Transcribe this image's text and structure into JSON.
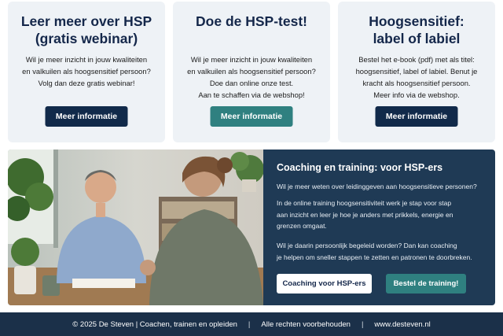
{
  "colors": {
    "navy_button": "#112a4a",
    "teal_button": "#2f8080",
    "panel_bg": "#1f3a55",
    "footer_bg": "#1b3049",
    "card_bg": "#eef2f6"
  },
  "cards": [
    {
      "title": [
        "Leer meer over HSP",
        "(gratis webinar)"
      ],
      "text": [
        "Wil je meer inzicht in jouw kwaliteiten",
        "en valkuilen als hoogsensitief persoon?",
        "Volg dan deze gratis webinar!"
      ],
      "button": "Meer informatie"
    },
    {
      "title": [
        "Doe de HSP-test!"
      ],
      "text": [
        "Wil je meer inzicht in jouw kwaliteiten",
        "en valkuilen als hoogsensitief persoon?",
        "Doe dan online onze test.",
        "Aan te schaffen via de webshop!"
      ],
      "button": "Meer informatie"
    },
    {
      "title": [
        "Hoogsensitief:",
        "label of labiel"
      ],
      "text": [
        "Bestel het e-book (pdf) met als titel:",
        "hoogsensitief, label of labiel. Benut je",
        "kracht als hoogsensitief persoon.",
        "Meer info via de webshop."
      ],
      "button": "Meer informatie"
    }
  ],
  "coaching": {
    "title": "Coaching en training: voor HSP-ers",
    "paragraphs": [
      [
        "Wil je meer weten over leidinggeven aan hoogsensitieve personen?"
      ],
      [
        "In de online training hoogsensitiviteit werk je stap voor stap",
        "aan inzicht en leer je hoe je anders met prikkels, energie en",
        "grenzen omgaat."
      ],
      [
        "Wil je daarin persoonlijk begeleid worden? Dan kan coaching",
        "je helpen om sneller stappen te zetten en patronen te doorbreken."
      ]
    ],
    "button_coaching": "Coaching voor HSP-ers",
    "button_training": "Bestel de training!"
  },
  "footer": {
    "copyright": "© 2025 De Steven | Coachen, trainen en opleiden",
    "separator": "|",
    "rights": "Alle rechten voorbehouden",
    "website": "www.desteven.nl"
  }
}
